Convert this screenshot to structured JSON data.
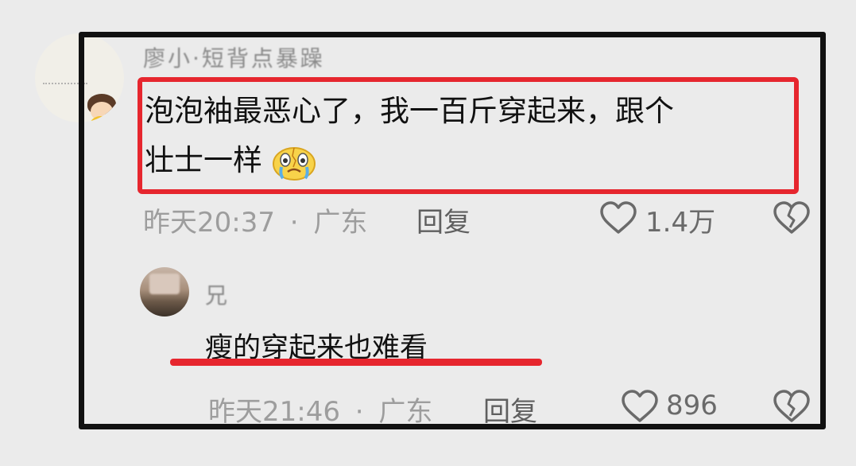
{
  "comments": [
    {
      "username": "廖小·短背点暴躁",
      "text_line1": "泡泡袖最恶心了，我一百斤穿起来，跟个",
      "text_line2": "壮士一样",
      "emoji": "crying-face-emoji",
      "time": "昨天20:37",
      "separator": "·",
      "location": "广东",
      "reply_label": "回复",
      "likes": "1.4万"
    },
    {
      "username": "兄",
      "text": "瘦的穿起来也难看",
      "time": "昨天21:46",
      "separator": "·",
      "location": "广东",
      "reply_label": "回复",
      "likes": "896"
    }
  ],
  "colors": {
    "annotation_red": "#e6262e",
    "frame_black": "#111111",
    "meta_gray": "#9d9d9d"
  },
  "icons": [
    "heart-icon",
    "broken-heart-icon"
  ]
}
